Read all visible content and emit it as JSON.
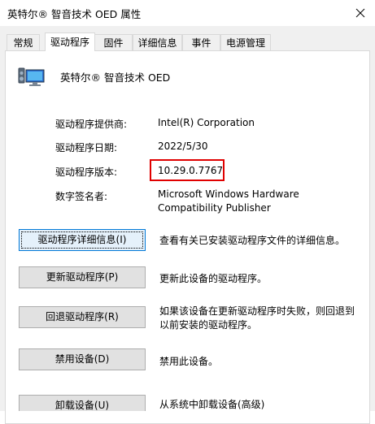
{
  "window": {
    "title": "英特尔® 智音技术 OED 属性"
  },
  "tabs": [
    {
      "label": "常规"
    },
    {
      "label": "驱动程序"
    },
    {
      "label": "固件"
    },
    {
      "label": "详细信息"
    },
    {
      "label": "事件"
    },
    {
      "label": "电源管理"
    }
  ],
  "device": {
    "name": "英特尔® 智音技术 OED",
    "icon": "speaker-monitor-icon"
  },
  "driver_info": {
    "provider_label": "驱动程序提供商:",
    "provider_value": "Intel(R) Corporation",
    "date_label": "驱动程序日期:",
    "date_value": "2022/5/30",
    "version_label": "驱动程序版本:",
    "version_value": "10.29.0.7767",
    "signer_label": "数字签名者:",
    "signer_value_line1": "Microsoft Windows Hardware",
    "signer_value_line2": "Compatibility Publisher"
  },
  "actions": {
    "details_button": "驱动程序详细信息(I)",
    "details_desc": "查看有关已安装驱动程序文件的详细信息。",
    "update_button": "更新驱动程序(P)",
    "update_desc": "更新此设备的驱动程序。",
    "rollback_button": "回退驱动程序(R)",
    "rollback_desc_line1": "如果该设备在更新驱动程序时失败，则回退到",
    "rollback_desc_line2": "以前安装的驱动程序。",
    "disable_button": "禁用设备(D)",
    "disable_desc": "禁用此设备。",
    "uninstall_button": "卸载设备(U)",
    "uninstall_desc": "从系统中卸载设备(高级)"
  },
  "colors": {
    "highlight": "#e00000",
    "focus": "#0078d7"
  }
}
